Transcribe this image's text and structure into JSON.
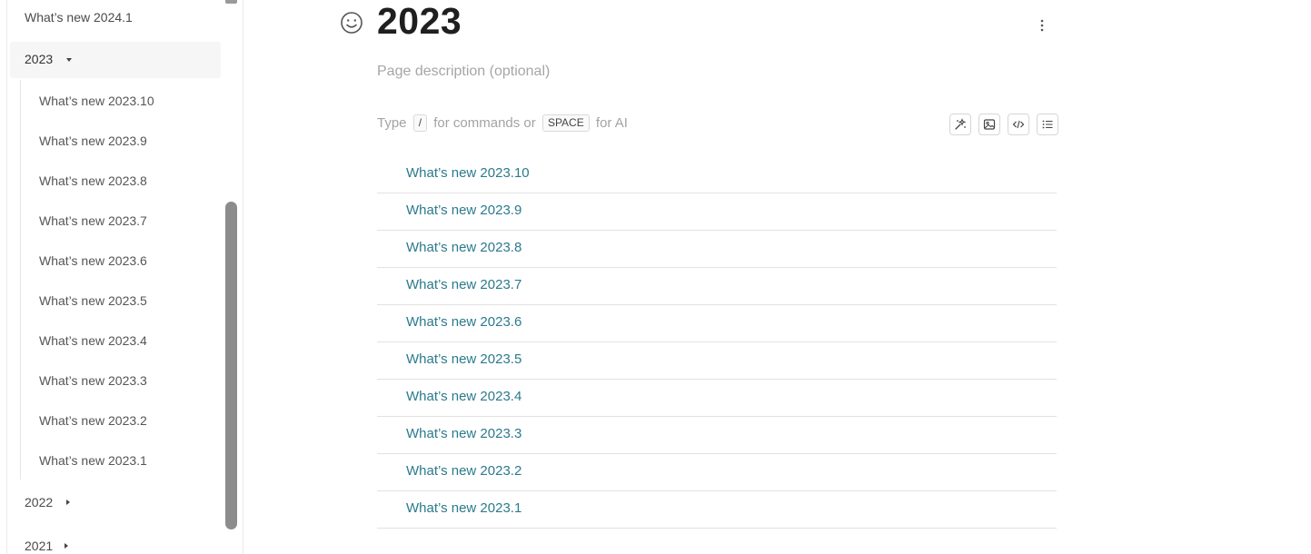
{
  "sidebar": {
    "top_item": "What’s new 2024.1",
    "group_2023": "2023",
    "sub_items": [
      "What’s new 2023.10",
      "What’s new 2023.9",
      "What’s new 2023.8",
      "What’s new 2023.7",
      "What’s new 2023.6",
      "What’s new 2023.5",
      "What’s new 2023.4",
      "What’s new 2023.3",
      "What’s new 2023.2",
      "What’s new 2023.1"
    ],
    "group_2022": "2022",
    "group_2021": "2021"
  },
  "page": {
    "title": "2023",
    "description_placeholder": "Page description (optional)",
    "hint": {
      "type": "Type",
      "slash": "/",
      "for_commands": "for commands or",
      "space": "SPACE",
      "for_ai": "for AI"
    },
    "toolbar_icons": [
      "ai-sparkle-icon",
      "image-icon",
      "code-icon",
      "list-icon"
    ],
    "child_pages": [
      "What’s new 2023.10",
      "What’s new 2023.9",
      "What’s new 2023.8",
      "What’s new 2023.7",
      "What’s new 2023.6",
      "What’s new 2023.5",
      "What’s new 2023.4",
      "What’s new 2023.3",
      "What’s new 2023.2",
      "What’s new 2023.1"
    ]
  },
  "colors": {
    "link": "#2b7a8c",
    "title": "#1f1f1f",
    "muted": "#a6a6a6"
  }
}
